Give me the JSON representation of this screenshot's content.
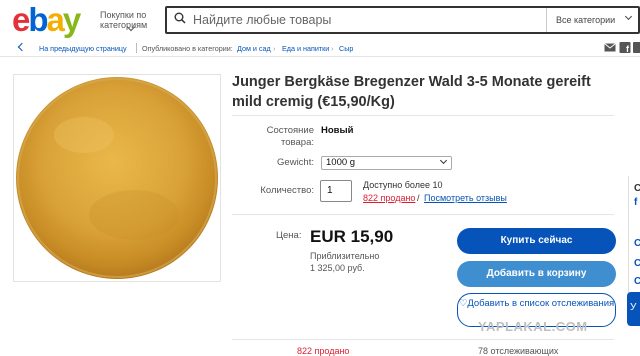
{
  "header": {
    "logo_letters": [
      {
        "ch": "e",
        "color": "#e53238"
      },
      {
        "ch": "b",
        "color": "#0064d2"
      },
      {
        "ch": "a",
        "color": "#f5af02"
      },
      {
        "ch": "y",
        "color": "#86b817"
      }
    ],
    "shop_by_category": "Покупки по категориям",
    "search_placeholder": "Найдите любые товары",
    "category_select": "Все категории"
  },
  "breadcrumb": {
    "back": "На предыдущую страницу",
    "listed_in": "Опубликовано в категории:",
    "items": [
      "Дом и сад",
      "Еда и напитки",
      "Сыр"
    ]
  },
  "listing": {
    "title": "Junger Bergkäse Bregenzer Wald 3-5 Monate gereift mild cremig (€15,90/Kg)",
    "condition_label": "Состояние товара:",
    "condition_value": "Новый",
    "weight_label": "Gewicht:",
    "weight_value": "1000 g",
    "quantity_label": "Количество:",
    "quantity_value": "1",
    "available": "Доступно более 10",
    "sold": "822 продано",
    "sold_sep": "/",
    "reviews": "Посмотреть отзывы",
    "price_label": "Цена:",
    "price": "EUR 15,90",
    "approx_label": "Приблизительно",
    "approx_value": "1 325,00 руб.",
    "buy_now": "Купить сейчас",
    "add_to_cart": "Добавить в корзину",
    "watch": "Добавить в список отслеживания",
    "bottom_sold": "822 продано",
    "bottom_watchers": "78 отслеживающих"
  },
  "right_panel": {
    "chars": [
      "С",
      "f",
      "С",
      "С",
      "С"
    ]
  },
  "watermark": "YAPLAKAL.COM",
  "colors": {
    "accent": "#0654ba",
    "sold_red": "#dd1e31",
    "cart_blue": "#3f8fd0"
  },
  "icons": [
    "search-icon",
    "chevron-down-icon",
    "back-chevron-icon",
    "mail-icon",
    "facebook-icon",
    "twitter-icon",
    "heart-icon"
  ]
}
